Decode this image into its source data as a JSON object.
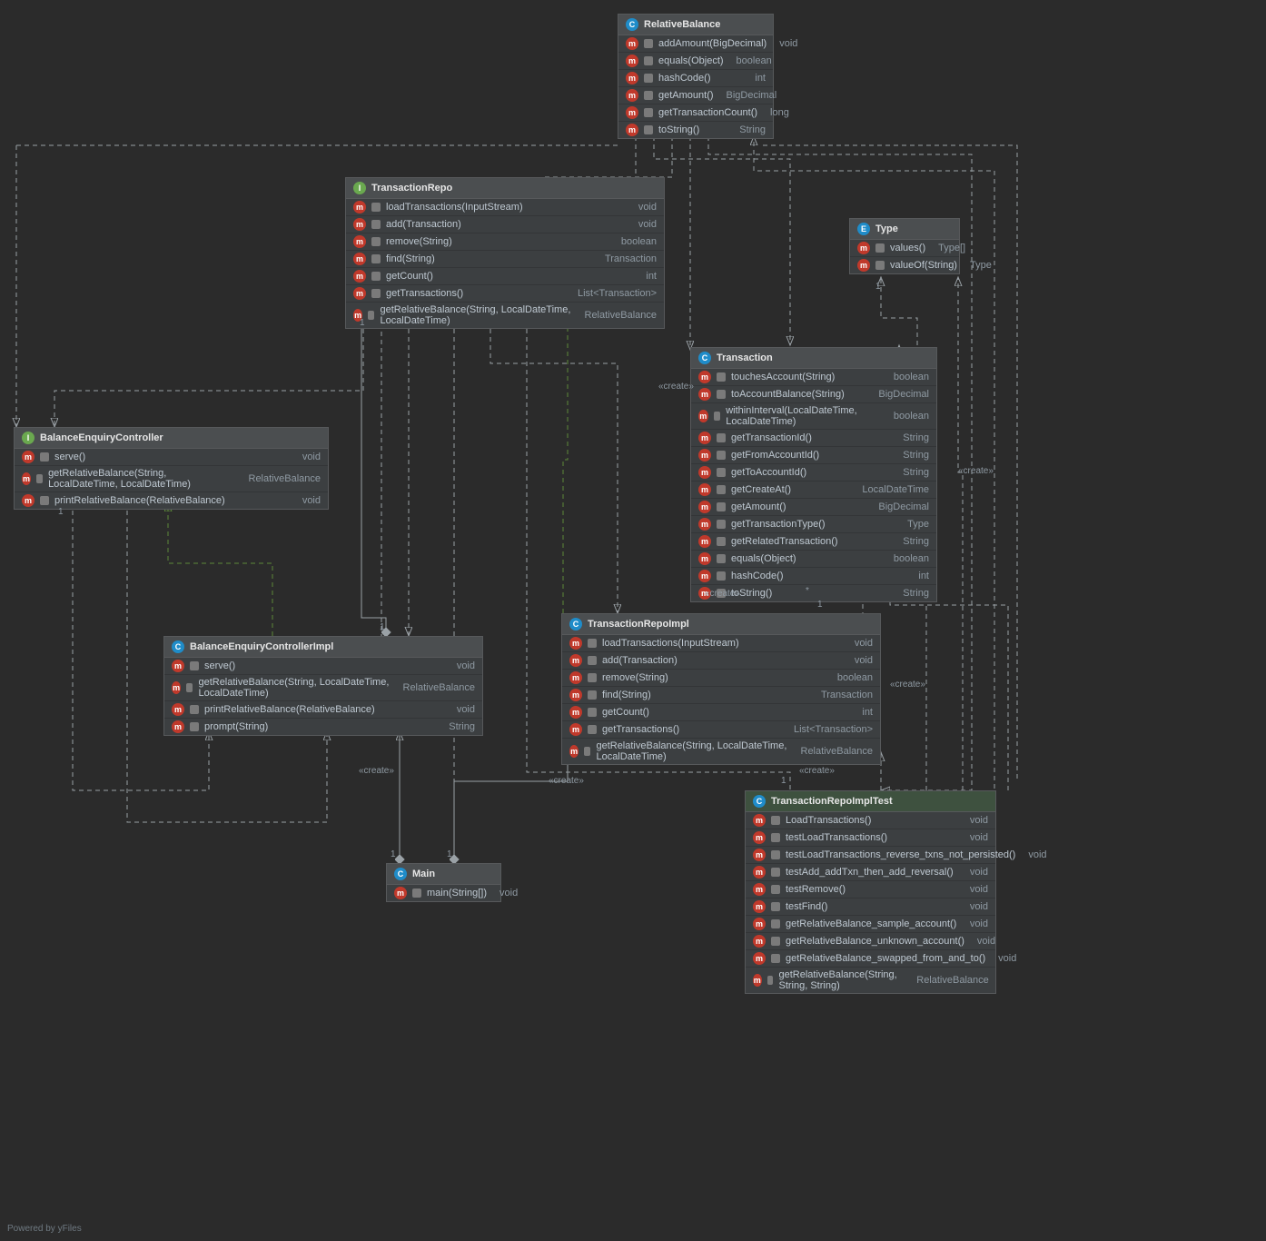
{
  "footer": "Powered by yFiles",
  "icons": {
    "class": "C",
    "interface": "I",
    "enum": "E",
    "method": "m"
  },
  "labels": {
    "create": "«create»",
    "one": "1",
    "star": "*"
  },
  "nodes": {
    "relativeBalance": {
      "title": "RelativeBalance",
      "methods": [
        {
          "sig": "addAmount(BigDecimal)",
          "ret": "void"
        },
        {
          "sig": "equals(Object)",
          "ret": "boolean"
        },
        {
          "sig": "hashCode()",
          "ret": "int"
        },
        {
          "sig": "getAmount()",
          "ret": "BigDecimal"
        },
        {
          "sig": "getTransactionCount()",
          "ret": "long"
        },
        {
          "sig": "toString()",
          "ret": "String"
        }
      ]
    },
    "type": {
      "title": "Type",
      "methods": [
        {
          "sig": "values()",
          "ret": "Type[]"
        },
        {
          "sig": "valueOf(String)",
          "ret": "Type"
        }
      ]
    },
    "transactionRepo": {
      "title": "TransactionRepo",
      "methods": [
        {
          "sig": "loadTransactions(InputStream)",
          "ret": "void"
        },
        {
          "sig": "add(Transaction)",
          "ret": "void"
        },
        {
          "sig": "remove(String)",
          "ret": "boolean"
        },
        {
          "sig": "find(String)",
          "ret": "Transaction"
        },
        {
          "sig": "getCount()",
          "ret": "int"
        },
        {
          "sig": "getTransactions()",
          "ret": "List<Transaction>"
        },
        {
          "sig": "getRelativeBalance(String, LocalDateTime, LocalDateTime)",
          "ret": "RelativeBalance"
        }
      ]
    },
    "transaction": {
      "title": "Transaction",
      "methods": [
        {
          "sig": "touchesAccount(String)",
          "ret": "boolean"
        },
        {
          "sig": "toAccountBalance(String)",
          "ret": "BigDecimal"
        },
        {
          "sig": "withinInterval(LocalDateTime, LocalDateTime)",
          "ret": "boolean"
        },
        {
          "sig": "getTransactionId()",
          "ret": "String"
        },
        {
          "sig": "getFromAccountId()",
          "ret": "String"
        },
        {
          "sig": "getToAccountId()",
          "ret": "String"
        },
        {
          "sig": "getCreateAt()",
          "ret": "LocalDateTime"
        },
        {
          "sig": "getAmount()",
          "ret": "BigDecimal"
        },
        {
          "sig": "getTransactionType()",
          "ret": "Type"
        },
        {
          "sig": "getRelatedTransaction()",
          "ret": "String"
        },
        {
          "sig": "equals(Object)",
          "ret": "boolean"
        },
        {
          "sig": "hashCode()",
          "ret": "int"
        },
        {
          "sig": "toString()",
          "ret": "String"
        }
      ]
    },
    "balanceEnquiryController": {
      "title": "BalanceEnquiryController",
      "methods": [
        {
          "sig": "serve()",
          "ret": "void"
        },
        {
          "sig": "getRelativeBalance(String, LocalDateTime, LocalDateTime)",
          "ret": "RelativeBalance"
        },
        {
          "sig": "printRelativeBalance(RelativeBalance)",
          "ret": "void"
        }
      ]
    },
    "balanceEnquiryControllerImpl": {
      "title": "BalanceEnquiryControllerImpl",
      "methods": [
        {
          "sig": "serve()",
          "ret": "void"
        },
        {
          "sig": "getRelativeBalance(String, LocalDateTime, LocalDateTime)",
          "ret": "RelativeBalance"
        },
        {
          "sig": "printRelativeBalance(RelativeBalance)",
          "ret": "void"
        },
        {
          "sig": "prompt(String)",
          "ret": "String"
        }
      ]
    },
    "transactionRepoImpl": {
      "title": "TransactionRepoImpl",
      "methods": [
        {
          "sig": "loadTransactions(InputStream)",
          "ret": "void"
        },
        {
          "sig": "add(Transaction)",
          "ret": "void"
        },
        {
          "sig": "remove(String)",
          "ret": "boolean"
        },
        {
          "sig": "find(String)",
          "ret": "Transaction"
        },
        {
          "sig": "getCount()",
          "ret": "int"
        },
        {
          "sig": "getTransactions()",
          "ret": "List<Transaction>"
        },
        {
          "sig": "getRelativeBalance(String, LocalDateTime, LocalDateTime)",
          "ret": "RelativeBalance"
        }
      ]
    },
    "main": {
      "title": "Main",
      "methods": [
        {
          "sig": "main(String[])",
          "ret": "void"
        }
      ]
    },
    "transactionRepoImplTest": {
      "title": "TransactionRepoImplTest",
      "methods": [
        {
          "sig": "LoadTransactions()",
          "ret": "void"
        },
        {
          "sig": "testLoadTransactions()",
          "ret": "void"
        },
        {
          "sig": "testLoadTransactions_reverse_txns_not_persisted()",
          "ret": "void"
        },
        {
          "sig": "testAdd_addTxn_then_add_reversal()",
          "ret": "void"
        },
        {
          "sig": "testRemove()",
          "ret": "void"
        },
        {
          "sig": "testFind()",
          "ret": "void"
        },
        {
          "sig": "getRelativeBalance_sample_account()",
          "ret": "void"
        },
        {
          "sig": "getRelativeBalance_unknown_account()",
          "ret": "void"
        },
        {
          "sig": "getRelativeBalance_swapped_from_and_to()",
          "ret": "void"
        },
        {
          "sig": "getRelativeBalance(String, String, String)",
          "ret": "RelativeBalance"
        }
      ]
    }
  }
}
